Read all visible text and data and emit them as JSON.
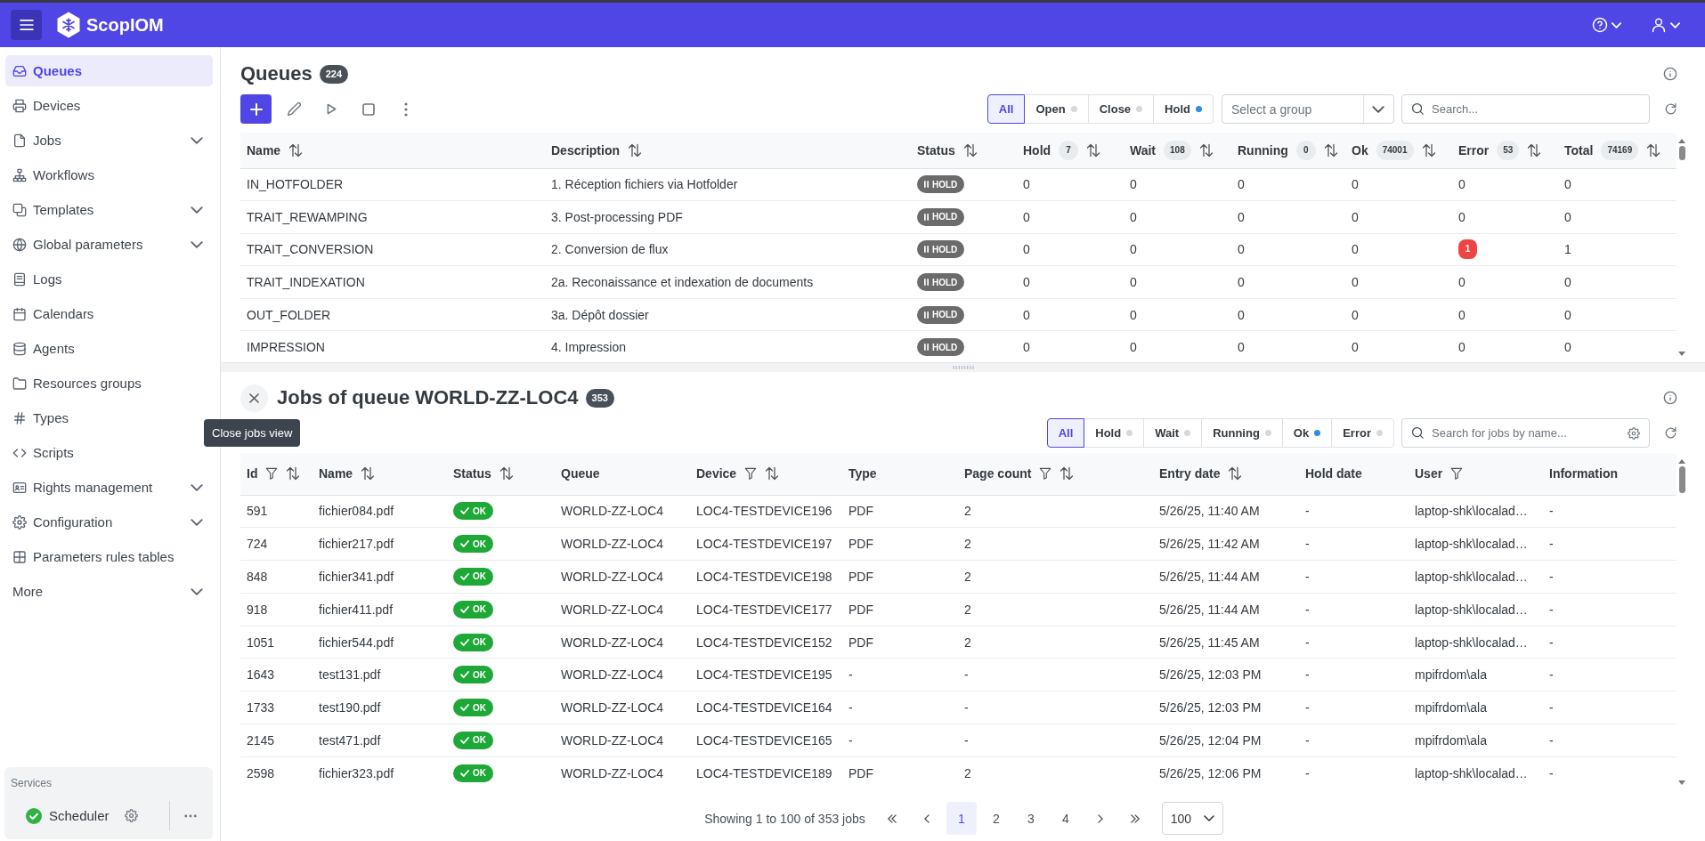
{
  "top_bar": {
    "app_name": "ScopIOM"
  },
  "sidebar": {
    "items": [
      {
        "label": "Queues",
        "selected": true,
        "submenu": false
      },
      {
        "label": "Devices",
        "selected": false,
        "submenu": false
      },
      {
        "label": "Jobs",
        "selected": false,
        "submenu": true
      },
      {
        "label": "Workflows",
        "selected": false,
        "submenu": false
      },
      {
        "label": "Templates",
        "selected": false,
        "submenu": true
      },
      {
        "label": "Global parameters",
        "selected": false,
        "submenu": true
      },
      {
        "label": "Logs",
        "selected": false,
        "submenu": false
      },
      {
        "label": "Calendars",
        "selected": false,
        "submenu": false
      },
      {
        "label": "Agents",
        "selected": false,
        "submenu": false
      },
      {
        "label": "Resources groups",
        "selected": false,
        "submenu": false
      },
      {
        "label": "Types",
        "selected": false,
        "submenu": false
      },
      {
        "label": "Scripts",
        "selected": false,
        "submenu": false
      },
      {
        "label": "Rights management",
        "selected": false,
        "submenu": true
      },
      {
        "label": "Configuration",
        "selected": false,
        "submenu": true
      },
      {
        "label": "Parameters rules tables",
        "selected": false,
        "submenu": false
      },
      {
        "label": "More",
        "selected": false,
        "submenu": true
      }
    ]
  },
  "services": {
    "title": "Services",
    "items": [
      {
        "name": "Scheduler",
        "running": true
      }
    ]
  },
  "queues": {
    "title": "Queues",
    "count": "224",
    "filters": [
      {
        "label": "All",
        "selected": true
      },
      {
        "label": "Open",
        "selected": false,
        "color": "#d5d8dc"
      },
      {
        "label": "Close",
        "selected": false,
        "color": "#d5d8dc"
      },
      {
        "label": "Hold",
        "selected": false,
        "color": "#2f8de4"
      }
    ],
    "group_select": {
      "placeholder": "Select a group"
    },
    "search": {
      "placeholder": "Search..."
    },
    "columns": [
      {
        "label": "Name",
        "sortable": true
      },
      {
        "label": "Description",
        "sortable": true
      },
      {
        "label": "Status",
        "sortable": true
      },
      {
        "label": "Hold",
        "count": "7",
        "sortable": true
      },
      {
        "label": "Wait",
        "count": "108",
        "sortable": true
      },
      {
        "label": "Running",
        "count": "0",
        "sortable": true
      },
      {
        "label": "Ok",
        "count": "74001",
        "sortable": true
      },
      {
        "label": "Error",
        "count": "53",
        "sortable": true
      },
      {
        "label": "Total",
        "count": "74169",
        "sortable": true
      }
    ],
    "rows": [
      {
        "name": "IN_HOTFOLDER",
        "description": "1. Réception fichiers via Hotfolder",
        "status": {
          "kind": "hold",
          "label": "HOLD"
        },
        "hold": "0",
        "wait": "0",
        "running": "0",
        "ok": "0",
        "error": "0",
        "error_alert": false,
        "total": "0"
      },
      {
        "name": "TRAIT_REWAMPING",
        "description": "3. Post-processing PDF",
        "status": {
          "kind": "hold",
          "label": "HOLD"
        },
        "hold": "0",
        "wait": "0",
        "running": "0",
        "ok": "0",
        "error": "0",
        "error_alert": false,
        "total": "0"
      },
      {
        "name": "TRAIT_CONVERSION",
        "description": "2. Conversion de flux",
        "status": {
          "kind": "hold",
          "label": "HOLD"
        },
        "hold": "0",
        "wait": "0",
        "running": "0",
        "ok": "0",
        "error": "1",
        "error_alert": true,
        "total": "1"
      },
      {
        "name": "TRAIT_INDEXATION",
        "description": "2a. Reconaissance et indexation de documents",
        "status": {
          "kind": "hold",
          "label": "HOLD"
        },
        "hold": "0",
        "wait": "0",
        "running": "0",
        "ok": "0",
        "error": "0",
        "error_alert": false,
        "total": "0"
      },
      {
        "name": "OUT_FOLDER",
        "description": "3a. Dépôt dossier",
        "status": {
          "kind": "hold",
          "label": "HOLD"
        },
        "hold": "0",
        "wait": "0",
        "running": "0",
        "ok": "0",
        "error": "0",
        "error_alert": false,
        "total": "0"
      },
      {
        "name": "IMPRESSION",
        "description": "4. Impression",
        "status": {
          "kind": "hold",
          "label": "HOLD"
        },
        "hold": "0",
        "wait": "0",
        "running": "0",
        "ok": "0",
        "error": "0",
        "error_alert": false,
        "total": "0"
      }
    ]
  },
  "jobs": {
    "title": "Jobs of queue WORLD-ZZ-LOC4",
    "count": "353",
    "close_tooltip": "Close jobs view",
    "filters": [
      {
        "label": "All",
        "selected": true
      },
      {
        "label": "Hold",
        "selected": false,
        "color": "#d5d8dc"
      },
      {
        "label": "Wait",
        "selected": false,
        "color": "#d5d8dc"
      },
      {
        "label": "Running",
        "selected": false,
        "color": "#d5d8dc"
      },
      {
        "label": "Ok",
        "selected": false,
        "color": "#2f8de4"
      },
      {
        "label": "Error",
        "selected": false,
        "color": "#d5d8dc"
      }
    ],
    "search": {
      "placeholder": "Search for jobs by name..."
    },
    "columns": [
      {
        "label": "Id",
        "filterable": true,
        "sortable": true
      },
      {
        "label": "Name",
        "filterable": false,
        "sortable": true
      },
      {
        "label": "Status",
        "filterable": false,
        "sortable": true
      },
      {
        "label": "Queue",
        "filterable": false,
        "sortable": false
      },
      {
        "label": "Device",
        "filterable": true,
        "sortable": true
      },
      {
        "label": "Type",
        "filterable": false,
        "sortable": false
      },
      {
        "label": "Page count",
        "filterable": true,
        "sortable": true
      },
      {
        "label": "Entry date",
        "filterable": false,
        "sortable": true
      },
      {
        "label": "Hold date",
        "filterable": false,
        "sortable": false
      },
      {
        "label": "User",
        "filterable": true,
        "sortable": false
      },
      {
        "label": "Information",
        "filterable": false,
        "sortable": false
      }
    ],
    "rows": [
      {
        "id": "591",
        "name": "fichier084.pdf",
        "status": {
          "kind": "ok",
          "label": "OK"
        },
        "queue": "WORLD-ZZ-LOC4",
        "device": "LOC4-TESTDEVICE196",
        "type": "PDF",
        "page_count": "2",
        "entry_date": "5/26/25, 11:40 AM",
        "hold_date": "-",
        "user": "laptop-shk\\localad…",
        "information": "-"
      },
      {
        "id": "724",
        "name": "fichier217.pdf",
        "status": {
          "kind": "ok",
          "label": "OK"
        },
        "queue": "WORLD-ZZ-LOC4",
        "device": "LOC4-TESTDEVICE197",
        "type": "PDF",
        "page_count": "2",
        "entry_date": "5/26/25, 11:42 AM",
        "hold_date": "-",
        "user": "laptop-shk\\localad…",
        "information": "-"
      },
      {
        "id": "848",
        "name": "fichier341.pdf",
        "status": {
          "kind": "ok",
          "label": "OK"
        },
        "queue": "WORLD-ZZ-LOC4",
        "device": "LOC4-TESTDEVICE198",
        "type": "PDF",
        "page_count": "2",
        "entry_date": "5/26/25, 11:44 AM",
        "hold_date": "-",
        "user": "laptop-shk\\localad…",
        "information": "-"
      },
      {
        "id": "918",
        "name": "fichier411.pdf",
        "status": {
          "kind": "ok",
          "label": "OK"
        },
        "queue": "WORLD-ZZ-LOC4",
        "device": "LOC4-TESTDEVICE177",
        "type": "PDF",
        "page_count": "2",
        "entry_date": "5/26/25, 11:44 AM",
        "hold_date": "-",
        "user": "laptop-shk\\localad…",
        "information": "-"
      },
      {
        "id": "1051",
        "name": "fichier544.pdf",
        "status": {
          "kind": "ok",
          "label": "OK"
        },
        "queue": "WORLD-ZZ-LOC4",
        "device": "LOC4-TESTDEVICE152",
        "type": "PDF",
        "page_count": "2",
        "entry_date": "5/26/25, 11:45 AM",
        "hold_date": "-",
        "user": "laptop-shk\\localad…",
        "information": "-"
      },
      {
        "id": "1643",
        "name": "test131.pdf",
        "status": {
          "kind": "ok",
          "label": "OK"
        },
        "queue": "WORLD-ZZ-LOC4",
        "device": "LOC4-TESTDEVICE195",
        "type": "-",
        "page_count": "-",
        "entry_date": "5/26/25, 12:03 PM",
        "hold_date": "-",
        "user": "mpifrdom\\ala",
        "information": "-"
      },
      {
        "id": "1733",
        "name": "test190.pdf",
        "status": {
          "kind": "ok",
          "label": "OK"
        },
        "queue": "WORLD-ZZ-LOC4",
        "device": "LOC4-TESTDEVICE164",
        "type": "-",
        "page_count": "-",
        "entry_date": "5/26/25, 12:03 PM",
        "hold_date": "-",
        "user": "mpifrdom\\ala",
        "information": "-"
      },
      {
        "id": "2145",
        "name": "test471.pdf",
        "status": {
          "kind": "ok",
          "label": "OK"
        },
        "queue": "WORLD-ZZ-LOC4",
        "device": "LOC4-TESTDEVICE165",
        "type": "-",
        "page_count": "-",
        "entry_date": "5/26/25, 12:04 PM",
        "hold_date": "-",
        "user": "mpifrdom\\ala",
        "information": "-"
      },
      {
        "id": "2598",
        "name": "fichier323.pdf",
        "status": {
          "kind": "ok",
          "label": "OK"
        },
        "queue": "WORLD-ZZ-LOC4",
        "device": "LOC4-TESTDEVICE189",
        "type": "PDF",
        "page_count": "2",
        "entry_date": "5/26/25, 12:06 PM",
        "hold_date": "-",
        "user": "laptop-shk\\localad…",
        "information": "-"
      }
    ],
    "pagination": {
      "summary": "Showing 1 to 100 of 353 jobs",
      "pages": [
        {
          "label": "1",
          "selected": true
        },
        {
          "label": "2",
          "selected": false
        },
        {
          "label": "3",
          "selected": false
        },
        {
          "label": "4",
          "selected": false
        }
      ],
      "page_size": "100"
    }
  }
}
